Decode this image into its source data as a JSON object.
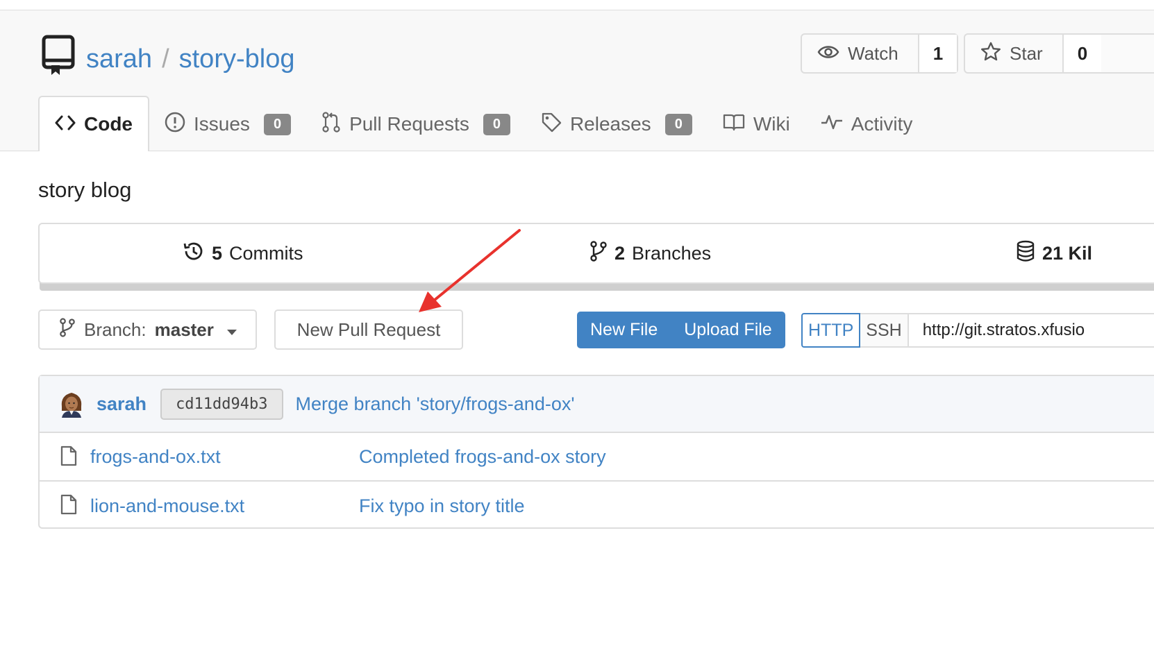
{
  "repo": {
    "owner": "sarah",
    "separator": "/",
    "name": "story-blog",
    "description": "story blog"
  },
  "actions": {
    "watch_label": "Watch",
    "watch_count": "1",
    "star_label": "Star",
    "star_count": "0"
  },
  "tabs": [
    {
      "label": "Code",
      "icon": "code-icon",
      "active": true
    },
    {
      "label": "Issues",
      "icon": "issue-icon",
      "badge": "0"
    },
    {
      "label": "Pull Requests",
      "icon": "pull-request-icon",
      "badge": "0"
    },
    {
      "label": "Releases",
      "icon": "tag-icon",
      "badge": "0"
    },
    {
      "label": "Wiki",
      "icon": "book-icon"
    },
    {
      "label": "Activity",
      "icon": "pulse-icon"
    }
  ],
  "stats": {
    "commits_count": "5",
    "commits_label": "Commits",
    "branches_count": "2",
    "branches_label": "Branches",
    "size_text": "21 Kil"
  },
  "toolbar": {
    "branch_prefix": "Branch:",
    "branch_name": "master",
    "new_pull_request": "New Pull Request",
    "new_file": "New File",
    "upload_file": "Upload File",
    "http_label": "HTTP",
    "ssh_label": "SSH",
    "clone_url": "http://git.stratos.xfusio"
  },
  "latest_commit": {
    "author": "sarah",
    "sha": "cd11dd94b3",
    "message": "Merge branch 'story/frogs-and-ox'"
  },
  "files": [
    {
      "name": "frogs-and-ox.txt",
      "message": "Completed frogs-and-ox story"
    },
    {
      "name": "lion-and-mouse.txt",
      "message": "Fix typo in story title"
    }
  ],
  "colors": {
    "link": "#4183c4",
    "primary_button": "#4183c4",
    "annotation_arrow": "#e8322d"
  }
}
